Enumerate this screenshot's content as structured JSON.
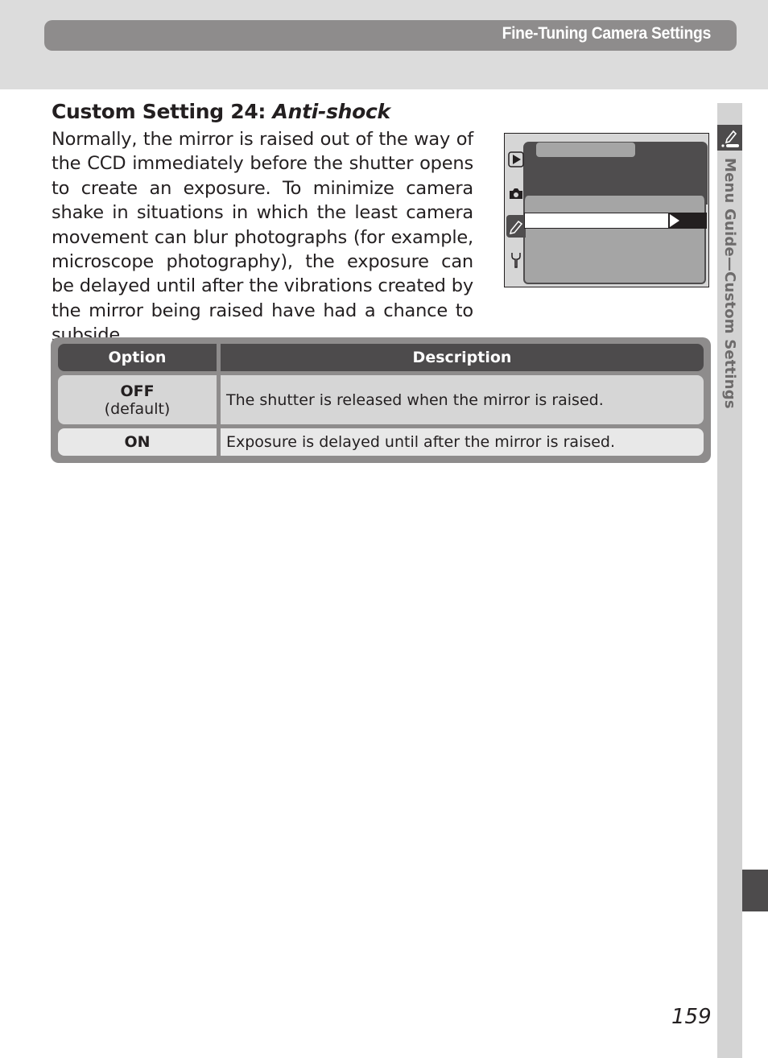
{
  "header": {
    "section_title": "Fine-Tuning Camera Settings"
  },
  "sidebar": {
    "label": "Menu Guide—Custom Settings",
    "icon": "pencil-icon"
  },
  "content": {
    "title_prefix": "Custom Setting 24: ",
    "title_italic": "Anti-shock",
    "paragraph": "Normally, the mirror is raised out of the way of the CCD immediately before the shutter opens to create an exposure.  To minimize camera shake in situations in which the least camera movement can blur photographs (for example, microscope photography), the exposure can be delayed until after the vibrations created by the mirror being raised have had a chance to subside."
  },
  "camera_screen": {
    "tab_icons": [
      "playback-icon",
      "camera-icon",
      "pencil-icon",
      "wrench-icon"
    ],
    "selected_tab": "pencil-icon"
  },
  "table": {
    "headers": [
      "Option",
      "Description"
    ],
    "rows": [
      {
        "option": "OFF",
        "option_note": "(default)",
        "description": "The shutter is released when the mirror is raised."
      },
      {
        "option": "ON",
        "option_note": "",
        "description": "Exposure is delayed until after the mirror is raised."
      }
    ]
  },
  "footer": {
    "page_number": "159"
  }
}
